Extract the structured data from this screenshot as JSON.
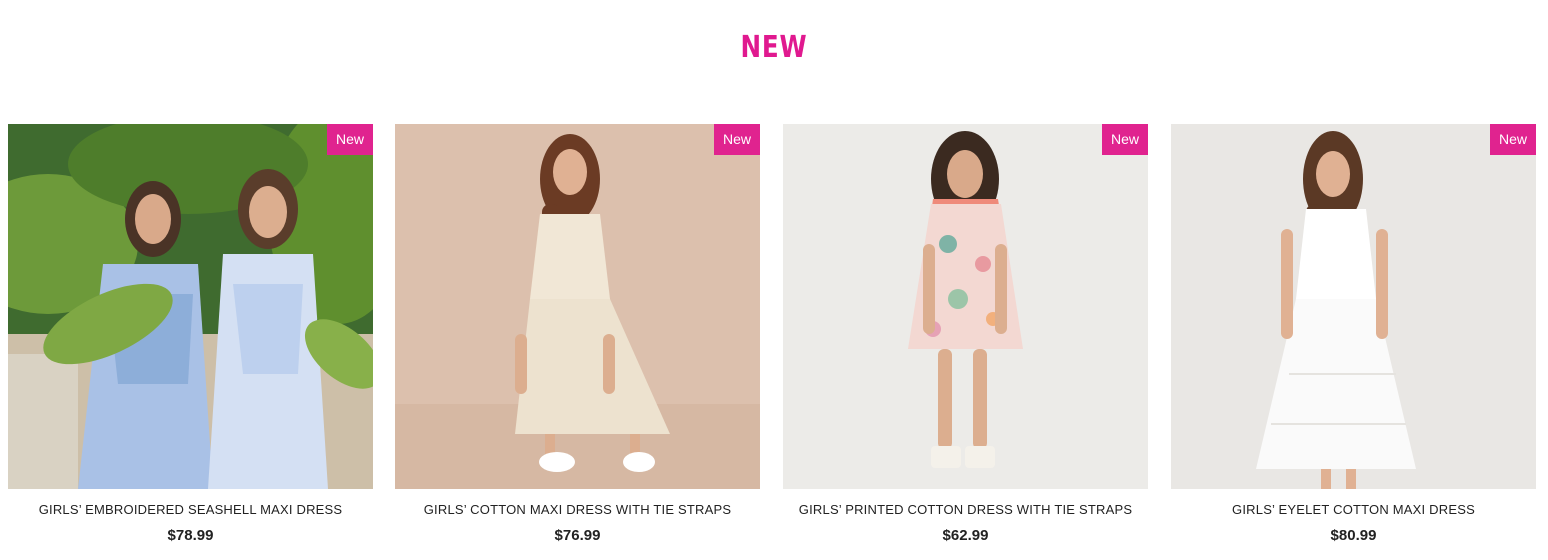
{
  "section": {
    "title": "NEW"
  },
  "products": [
    {
      "badge": "New",
      "name": "GIRLS’ EMBROIDERED SEASHELL MAXI DRESS",
      "price": "$78.99"
    },
    {
      "badge": "New",
      "name": "GIRLS’ COTTON MAXI DRESS WITH TIE STRAPS",
      "price": "$76.99"
    },
    {
      "badge": "New",
      "name": "GIRLS’ PRINTED COTTON DRESS WITH TIE STRAPS",
      "price": "$62.99"
    },
    {
      "badge": "New",
      "name": "GIRLS’ EYELET COTTON MAXI DRESS",
      "price": "$80.99"
    }
  ],
  "colors": {
    "accent": "#e0238f",
    "text": "#222222"
  }
}
